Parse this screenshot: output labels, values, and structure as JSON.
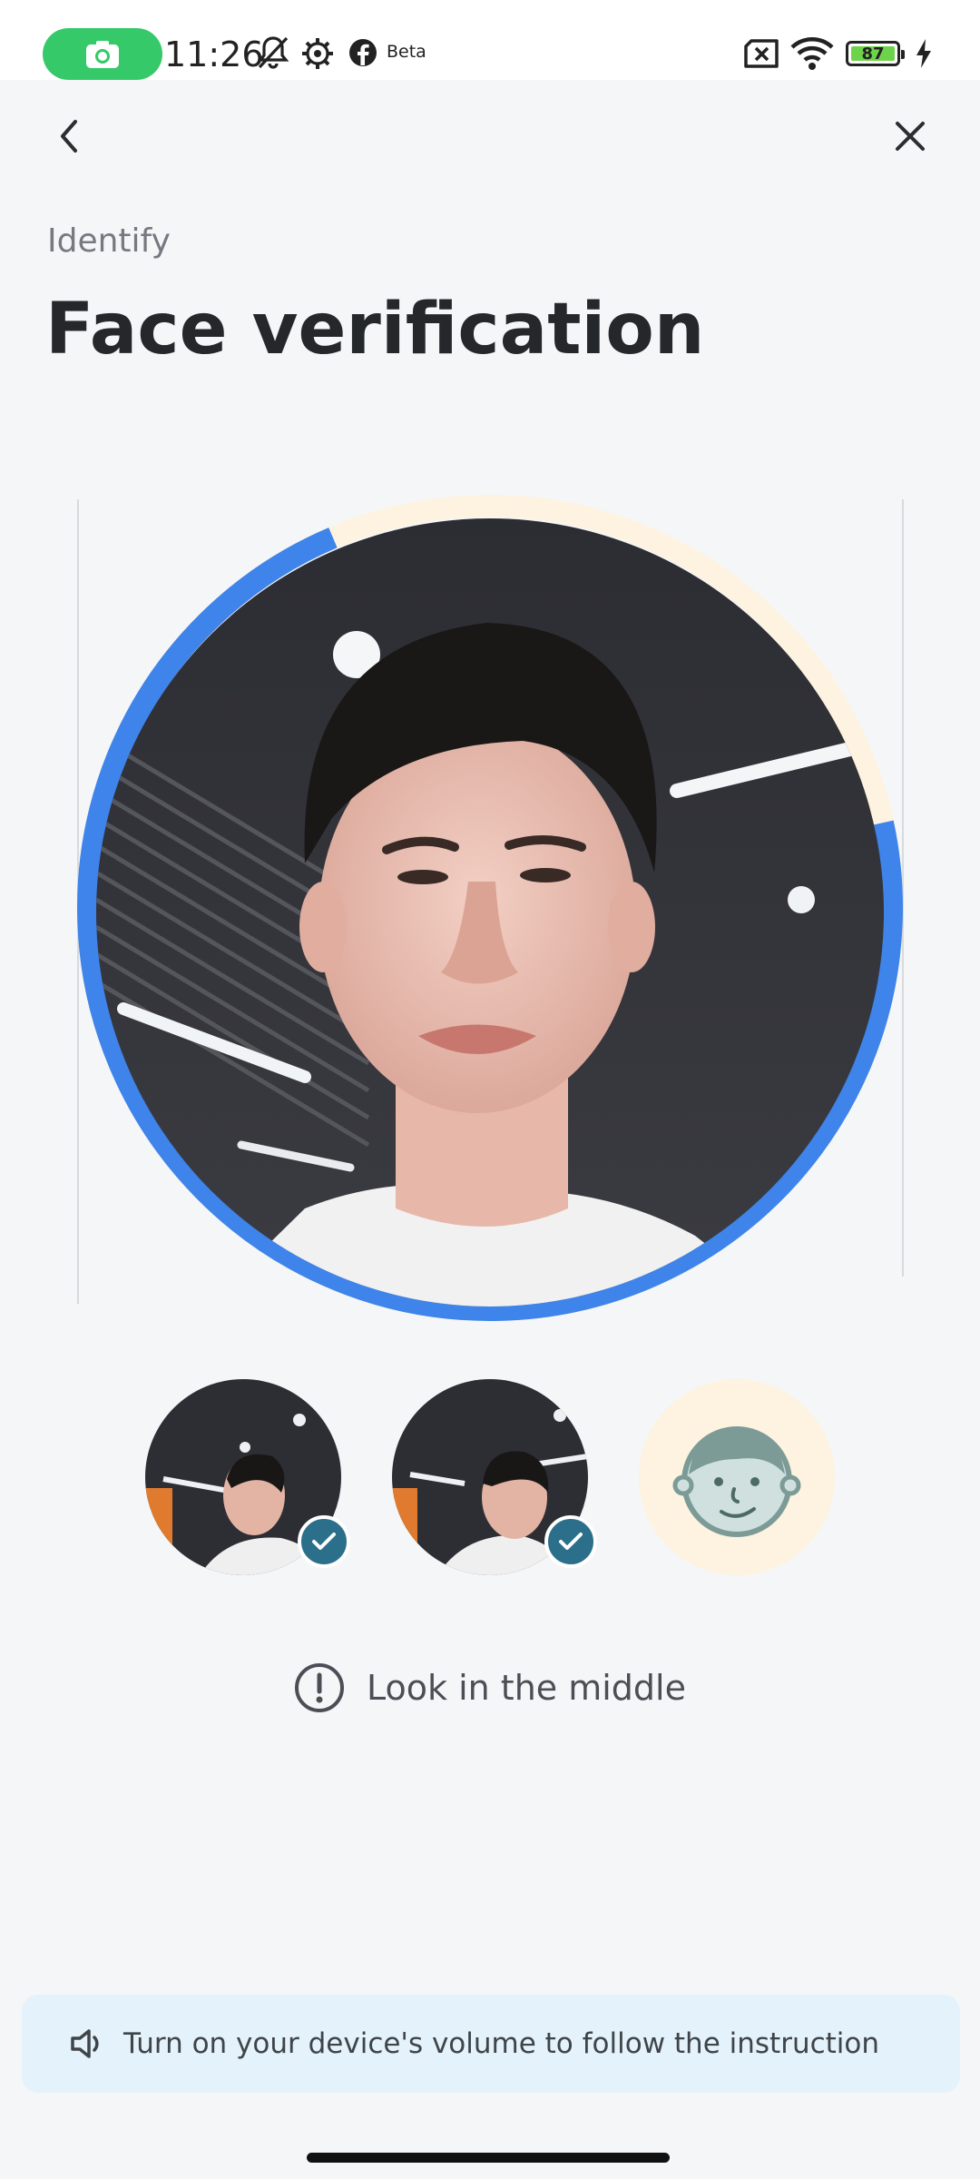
{
  "status_bar": {
    "time": "11:26",
    "beta_label": "Beta",
    "battery_level": "87",
    "icons": [
      "screen-record-icon",
      "notifications-off-icon",
      "settings-gear-icon",
      "facebook-icon",
      "sim-disabled-icon",
      "wifi-icon",
      "battery-icon",
      "charging-bolt-icon"
    ]
  },
  "nav": {
    "back_icon": "chevron-left-icon",
    "close_icon": "close-icon"
  },
  "header": {
    "overline": "Identify",
    "title": "Face verification"
  },
  "capture": {
    "progress_color": "#3e84ea",
    "track_color": "#fdf3e0",
    "progress": 0.72
  },
  "steps": [
    {
      "label": "face-left",
      "done": true
    },
    {
      "label": "face-right",
      "done": true
    },
    {
      "label": "face-middle",
      "done": false
    }
  ],
  "instruction": {
    "text": "Look in the middle",
    "icon": "info-circle-icon"
  },
  "volume_banner": {
    "text": "Turn on your device's volume to follow the instruction",
    "icon": "speaker-icon"
  },
  "colors": {
    "accent_blue": "#3e84ea",
    "check_badge": "#2b6f8a",
    "banner_bg": "#e3f2fb"
  }
}
